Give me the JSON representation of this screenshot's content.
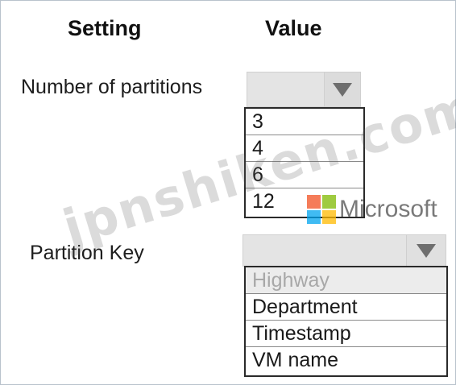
{
  "headers": {
    "setting": "Setting",
    "value": "Value"
  },
  "rows": [
    {
      "label": "Number of partitions",
      "options": [
        "3",
        "4",
        "6",
        "12"
      ]
    },
    {
      "label": "Partition Key",
      "options": [
        "Highway",
        "Department",
        "Timestamp",
        "VM name"
      ]
    }
  ],
  "logo": {
    "text": "Microsoft",
    "colors": [
      "#f25022",
      "#7fba00",
      "#00a4ef",
      "#ffb900"
    ]
  },
  "watermark": "jpnshiken.com"
}
